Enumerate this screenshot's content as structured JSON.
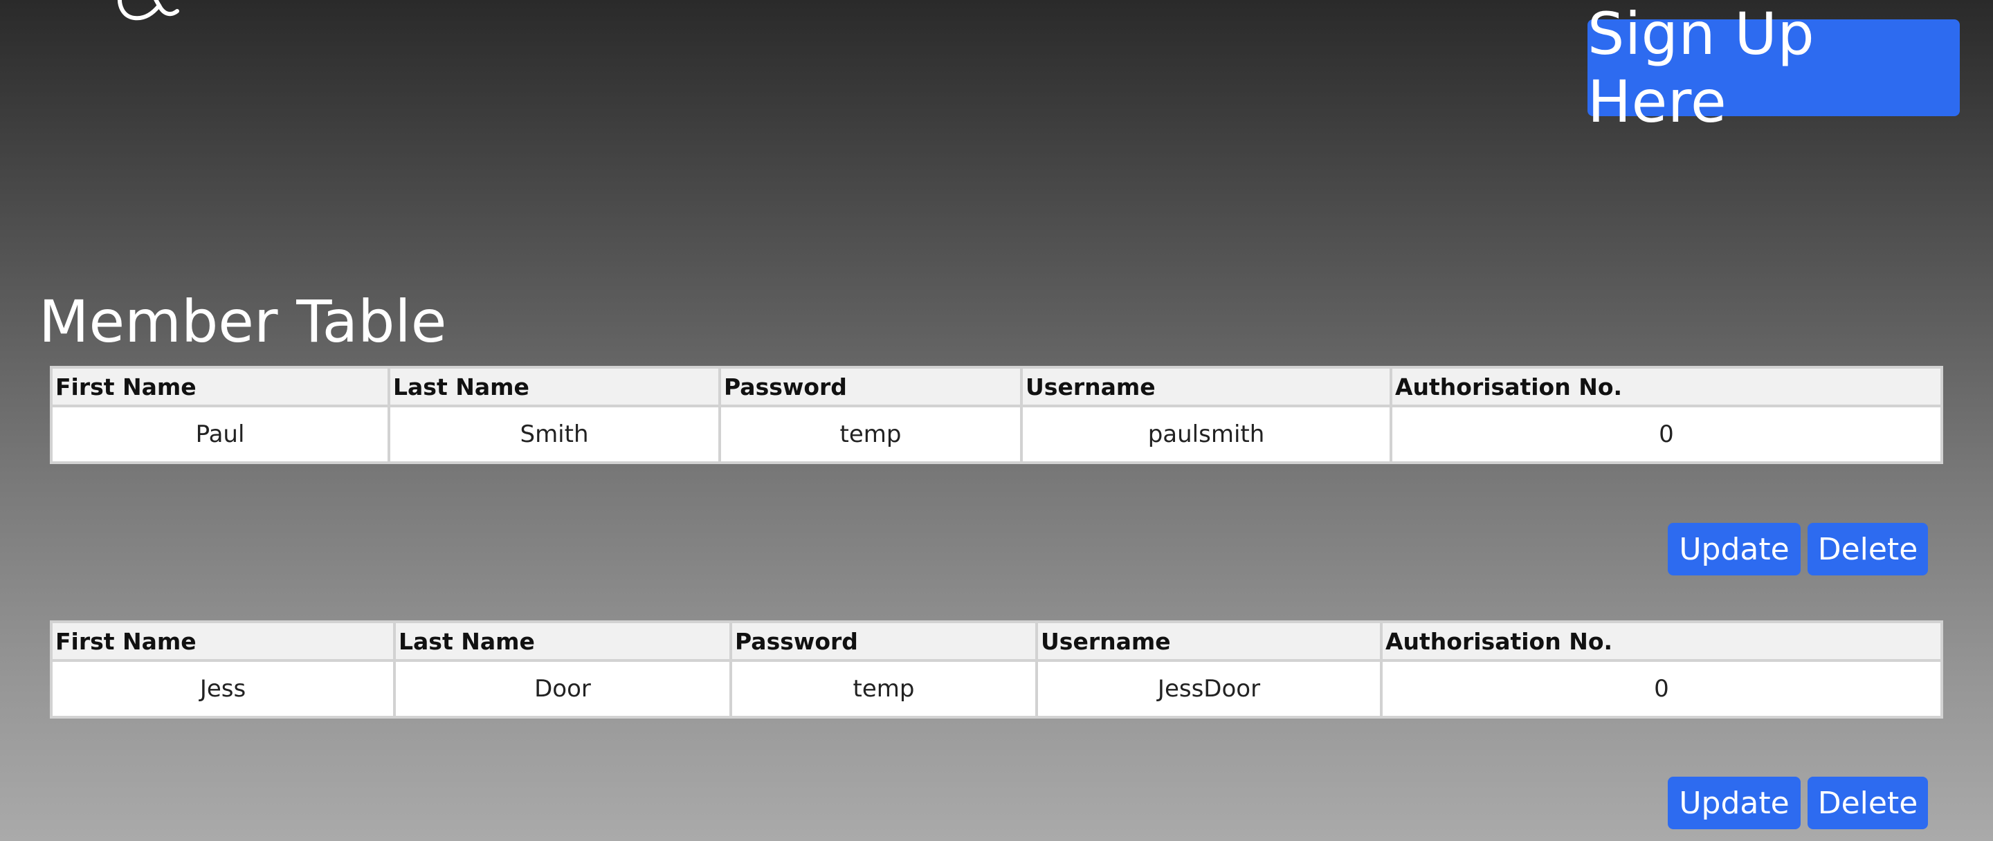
{
  "header": {
    "signup_label": "Sign Up Here"
  },
  "page": {
    "title": "Member Table"
  },
  "table": {
    "columns": [
      "First Name",
      "Last Name",
      "Password",
      "Username",
      "Authorisation No."
    ],
    "members": [
      {
        "first_name": "Paul",
        "last_name": "Smith",
        "password": "temp",
        "username": "paulsmith",
        "auth_no": "0"
      },
      {
        "first_name": "Jess",
        "last_name": "Door",
        "password": "temp",
        "username": "JessDoor",
        "auth_no": "0"
      }
    ]
  },
  "actions": {
    "update_label": "Update",
    "delete_label": "Delete"
  },
  "colors": {
    "button_blue": "#2d6bf0",
    "background_top": "#2a2a2a",
    "background_bottom": "#aaaaaa"
  }
}
